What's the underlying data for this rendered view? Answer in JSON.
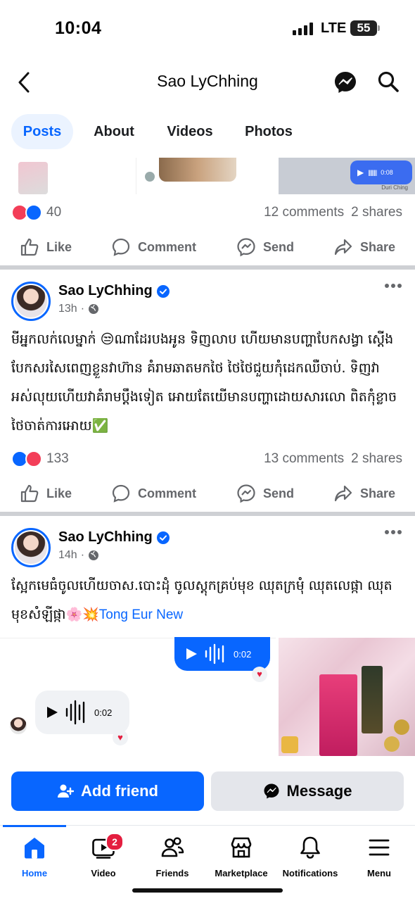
{
  "status_bar": {
    "time": "10:04",
    "network": "LTE",
    "battery": "55"
  },
  "header": {
    "title": "Sao LyChhing",
    "back_icon": "back-chevron-icon",
    "messenger_icon": "messenger-icon",
    "search_icon": "search-icon"
  },
  "tabs": [
    {
      "label": "Posts",
      "active": true
    },
    {
      "label": "About"
    },
    {
      "label": "Videos"
    },
    {
      "label": "Photos"
    }
  ],
  "strip": {
    "voice_duration": "0:08",
    "sender_label": "Duri Ching"
  },
  "post1_footer": {
    "reactions": [
      "love",
      "like"
    ],
    "reaction_count": "40",
    "comments": "12 comments",
    "shares": "2 shares"
  },
  "actions": {
    "like": "Like",
    "comment": "Comment",
    "send": "Send",
    "share": "Share"
  },
  "post2": {
    "author": "Sao LyChhing",
    "time": "13h",
    "text": "មីអ្នកលក់លេម្នាក់ 😒ណាដែរបងអូន ទិញលាប ហើយមានបញ្ហាបែកសង្វា ស្តើងបែកសរសៃពេញខ្លួនវាហ៊ាន គំរាមឆាតមកថៃ ថៃថៃជួយកុំដេកឈឺចាប់. ទិញវាអស់លុយហើយវាគំរាមប្តឹងទៀត អោយតែយើមានបញ្ហាដោយសារលោ ពិតកុំខ្លាច ថៃចាត់ការអោយ✅",
    "reactions": [
      "like",
      "love"
    ],
    "reaction_count": "133",
    "comments": "13 comments",
    "shares": "2 shares"
  },
  "post3": {
    "author": "Sao LyChhing",
    "time": "14h",
    "text": "ស្អែកមេធំចូលហើយចាស.បោះដុំ ចូលស្តុកគ្រប់មុខ ឈុតក្រមុំ ឈុតលេផ្កា ឈុតមុខសំឡីផ្កា🌸💥",
    "tag": "Tong Eur New",
    "voice_sent_duration": "0:02",
    "voice_received_duration": "0:02"
  },
  "buttons": {
    "add_friend": "Add friend",
    "message": "Message"
  },
  "bottom_nav": [
    {
      "label": "Home",
      "icon": "home-icon",
      "active": true
    },
    {
      "label": "Video",
      "icon": "video-icon",
      "badge": "2"
    },
    {
      "label": "Friends",
      "icon": "friends-icon"
    },
    {
      "label": "Marketplace",
      "icon": "marketplace-icon"
    },
    {
      "label": "Notifications",
      "icon": "bell-icon"
    },
    {
      "label": "Menu",
      "icon": "menu-icon"
    }
  ],
  "colors": {
    "accent": "#0866ff",
    "love": "#f33e58",
    "muted": "#65676b"
  }
}
